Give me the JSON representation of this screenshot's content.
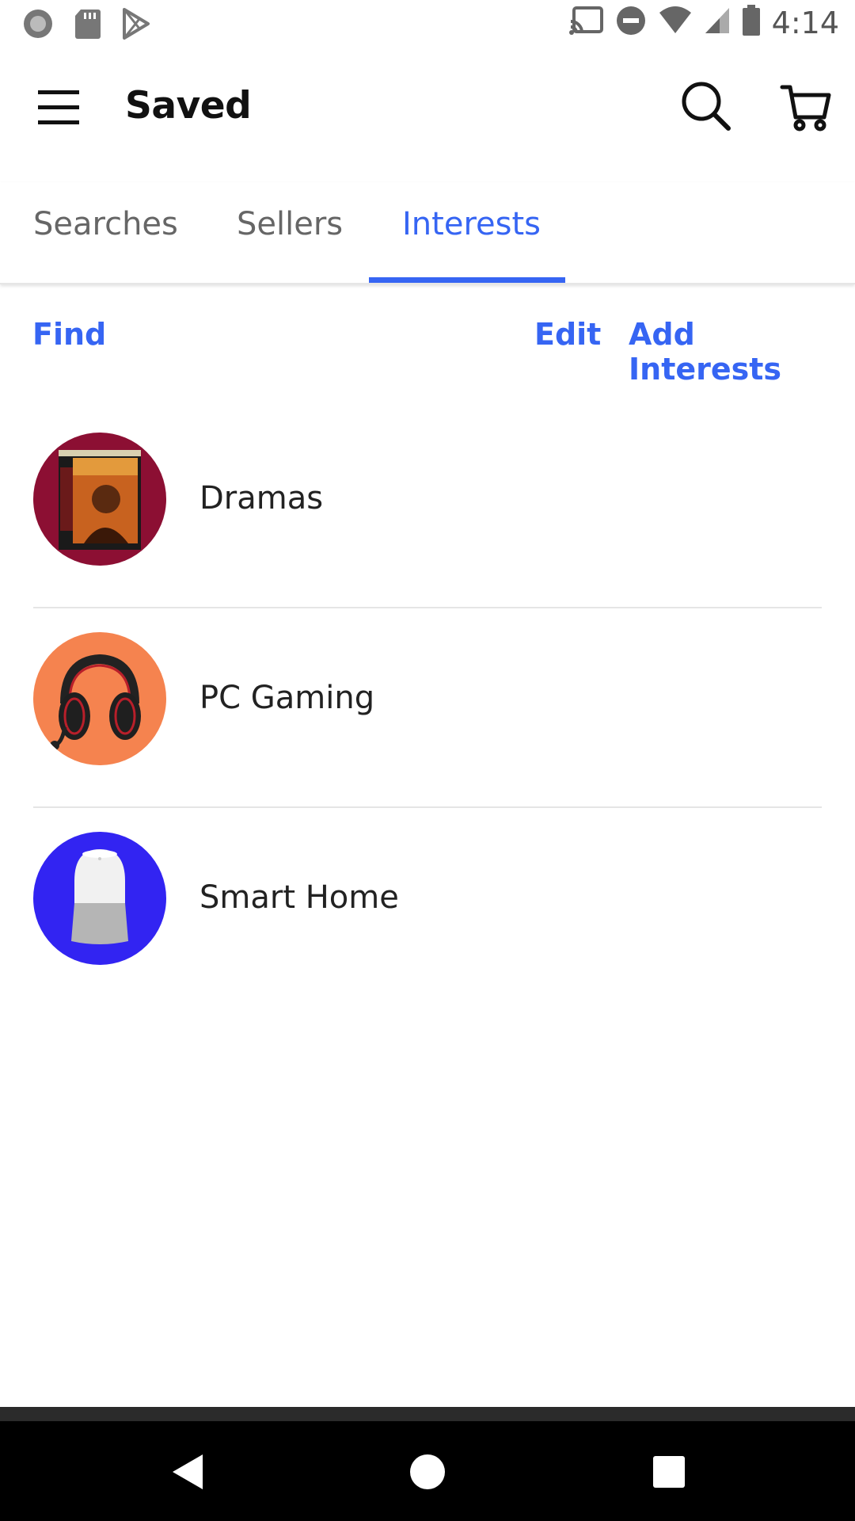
{
  "status_bar": {
    "time": "4:14",
    "left_icons": [
      "record-icon",
      "sd-card-icon",
      "play-store-icon"
    ],
    "right_icons": [
      "cast-icon",
      "do-not-disturb-icon",
      "wifi-icon",
      "signal-icon",
      "battery-icon"
    ]
  },
  "app_bar": {
    "title": "Saved",
    "icons": [
      "menu-icon",
      "search-icon",
      "cart-icon"
    ]
  },
  "tabs": [
    {
      "label": "Searches",
      "active": false
    },
    {
      "label": "Sellers",
      "active": false
    },
    {
      "label": "Interests",
      "active": true
    }
  ],
  "actions": {
    "find": "Find",
    "edit": "Edit",
    "add_interests": "Add Interests"
  },
  "interests": [
    {
      "label": "Dramas",
      "avatar_bg": "#8c0f33",
      "icon": "movie-poster-icon"
    },
    {
      "label": "PC Gaming",
      "avatar_bg": "#f5834f",
      "icon": "headset-icon"
    },
    {
      "label": "Smart Home",
      "avatar_bg": "#3224f2",
      "icon": "smart-speaker-icon"
    }
  ],
  "colors": {
    "accent": "#3665f3",
    "title_text": "#111111",
    "tab_inactive": "#666666"
  },
  "nav_bar": {
    "icons": [
      "back-icon",
      "home-icon",
      "recents-icon"
    ]
  }
}
